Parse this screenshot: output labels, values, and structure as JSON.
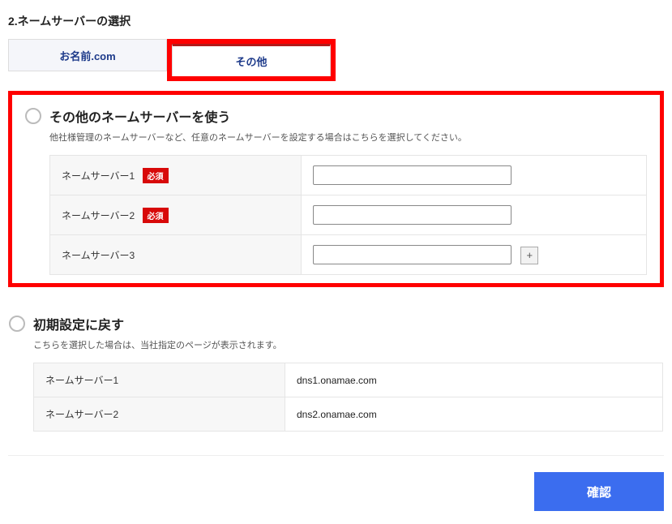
{
  "section_title": "2.ネームサーバーの選択",
  "tabs": {
    "onamae": "お名前.com",
    "other": "その他"
  },
  "panel_other": {
    "title": "その他のネームサーバーを使う",
    "desc": "他社様管理のネームサーバーなど、任意のネームサーバーを設定する場合はこちらを選択してください。",
    "rows": [
      {
        "label": "ネームサーバー1",
        "required": true
      },
      {
        "label": "ネームサーバー2",
        "required": true
      },
      {
        "label": "ネームサーバー3",
        "required": false,
        "add": true
      }
    ],
    "required_badge": "必須"
  },
  "panel_default": {
    "title": "初期設定に戻す",
    "desc": "こちらを選択した場合は、当社指定のページが表示されます。",
    "rows": [
      {
        "label": "ネームサーバー1",
        "value": "dns1.onamae.com"
      },
      {
        "label": "ネームサーバー2",
        "value": "dns2.onamae.com"
      }
    ]
  },
  "confirm_label": "確認",
  "add_icon": "+"
}
